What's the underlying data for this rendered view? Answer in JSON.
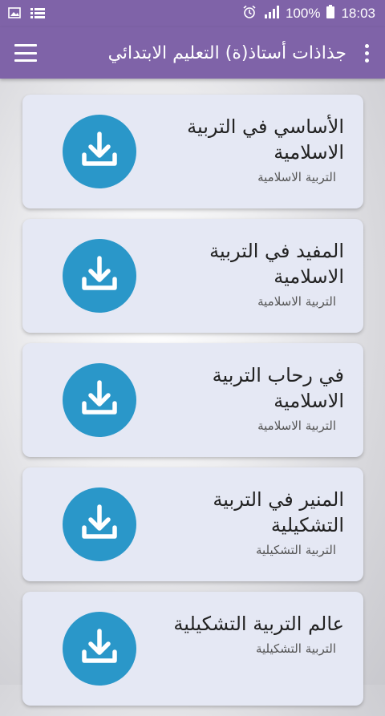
{
  "status_bar": {
    "battery": "100%",
    "time": "18:03"
  },
  "app_bar": {
    "title": "جذاذات أستاذ(ة) التعليم الابتدائي"
  },
  "colors": {
    "app_bar": "#7f63a8",
    "card_background": "#e5e8f4",
    "download_button": "#2a97c9"
  },
  "items": [
    {
      "title": "الأساسي في التربية الاسلامية",
      "subtitle": "التربية الاسلامية"
    },
    {
      "title": "المفيد في التربية الاسلامية",
      "subtitle": "التربية الاسلامية"
    },
    {
      "title": "في رحاب التربية الاسلامية",
      "subtitle": "التربية الاسلامية"
    },
    {
      "title": "المنير في التربية التشكيلية",
      "subtitle": "التربية التشكيلية"
    },
    {
      "title": "عالم التربية التشكيلية",
      "subtitle": "التربية التشكيلية"
    }
  ]
}
